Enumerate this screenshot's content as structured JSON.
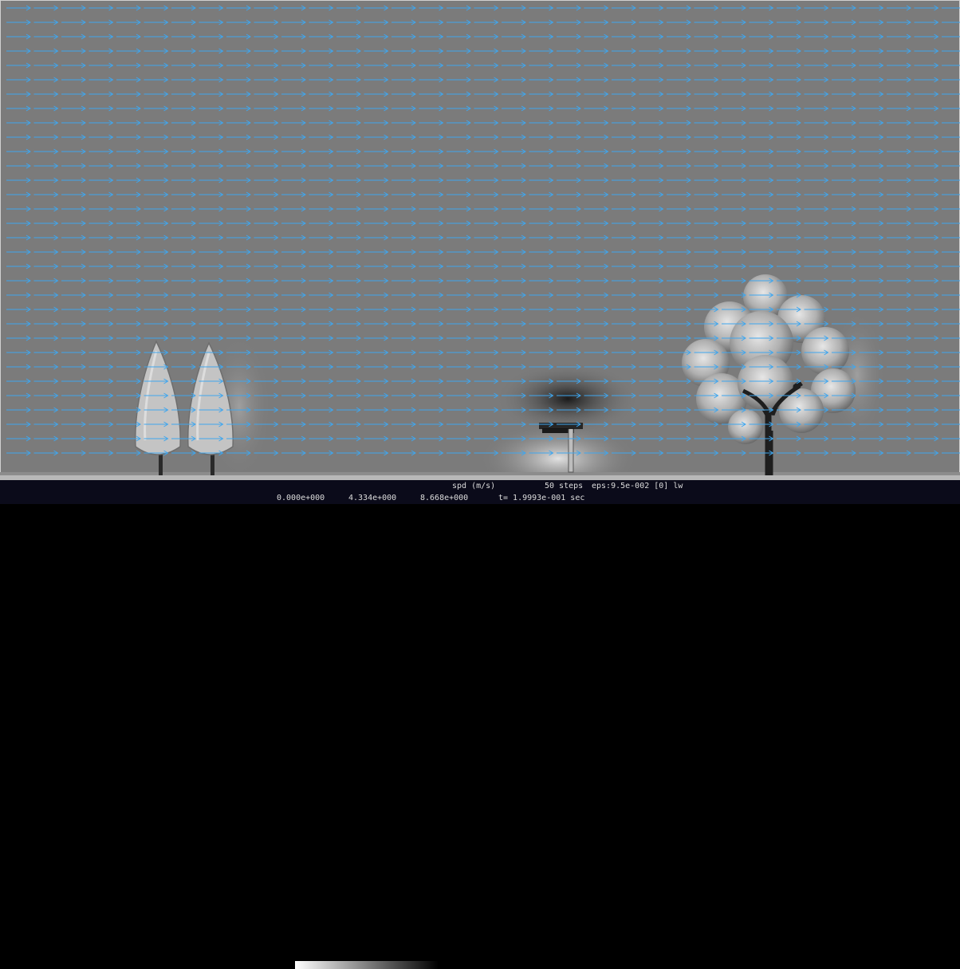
{
  "chart_data": {
    "type": "vector-field",
    "title": "",
    "quantity": "spd (m/s)",
    "colormap": "white-to-black",
    "colorbar_ticks": [
      "0.000e+000",
      "4.334e+000",
      "8.668e+000"
    ],
    "colorbar_range": [
      0.0,
      8.668
    ],
    "background_speed": 4.334,
    "vector_color": "#3fa6ee",
    "vector_direction": "left-to-right",
    "vector_grid": {
      "columns": 35,
      "rows": 32
    },
    "features": [
      {
        "name": "columnar-tree-left",
        "kind": "tree",
        "shape": "columnar"
      },
      {
        "name": "columnar-tree-right",
        "kind": "tree",
        "shape": "columnar"
      },
      {
        "name": "structure",
        "kind": "building",
        "shape": "post-with-cap"
      },
      {
        "name": "broadleaf-tree",
        "kind": "tree",
        "shape": "round-crown"
      }
    ]
  },
  "status": {
    "quantity_label": "spd (m/s)",
    "steps": "50 steps",
    "eps": "eps:9.5e-002 [0] lw",
    "tick_min": "0.000e+000",
    "tick_mid": "4.334e+000",
    "tick_max": "8.668e+000",
    "time": "t= 1.9993e-001 sec"
  }
}
